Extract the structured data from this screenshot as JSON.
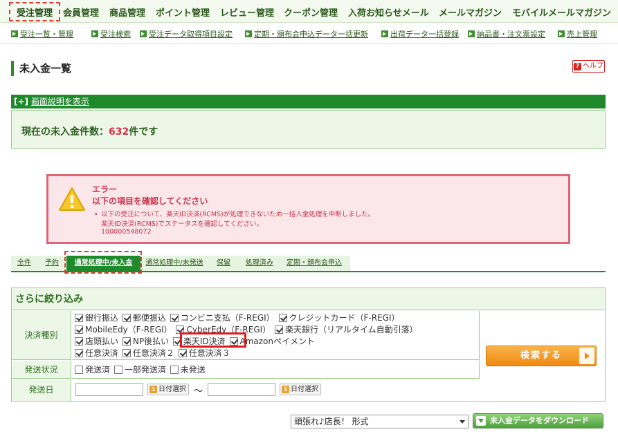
{
  "topnav": {
    "items": [
      "受注管理",
      "会員管理",
      "商品管理",
      "ポイント管理",
      "レビュー管理",
      "クーポン管理",
      "入荷お知らせメール",
      "メールマガジン",
      "モバイルメールマガジン"
    ]
  },
  "subnav": {
    "items": [
      "受注一覧・管理",
      "受注検索",
      "受注データ取得項目設定",
      "定期・頒布会申込データ一括更新",
      "出荷データ一括登録",
      "納品書・注文票設定",
      "売上管理"
    ]
  },
  "page": {
    "title": "未入金一覧",
    "help_label": "ヘルプ",
    "expander_prefix": "[+]",
    "expander_label": "画面説明を表示",
    "count_prefix": "現在の未入金件数：",
    "count_value": "632",
    "count_suffix": "件です"
  },
  "error": {
    "title": "エラー",
    "subtitle": "以下の項目を確認してください",
    "line1": "以下の受注について、楽天ID決済(RCMS)が処理できないため一括入金処理を中断しました。",
    "line2": "楽天ID決済(RCMS)でステータスを確認してください。",
    "order_no": "100000548072"
  },
  "tabs": [
    "全件",
    "予約",
    "通常処理中/未入金",
    "通常処理中/未発送",
    "保留",
    "処理済み",
    "定期・頒布会申込"
  ],
  "filter": {
    "title": "さらに絞り込み",
    "payment_label": "決済種別",
    "payment_options": [
      [
        "銀行振込",
        "郵便振込",
        "コンビニ支払（F-REGI）",
        "クレジットカード（F-REGI）"
      ],
      [
        "MobileEdy（F-REGI）",
        "CyberEdy（F-REGI）",
        "楽天銀行（リアルタイム自動引落）"
      ],
      [
        "店頭払い",
        "NP後払い",
        "楽天ID決済",
        "Amazonペイメント"
      ],
      [
        "任意決済",
        "任意決済２",
        "任意決済３"
      ]
    ],
    "shipping_label": "発送状況",
    "shipping_options": [
      "発送済",
      "一部発送済",
      "未発送"
    ],
    "date_label": "発送日",
    "date_btn_label": "日付選択",
    "date_btn_icon": "1",
    "tilde": "～",
    "search_label": "検索する"
  },
  "bottom": {
    "format_selected": "頑張れ♪店長！ 形式",
    "download_label": "未入金データをダウンロード"
  },
  "colors": {
    "green": "#1f8a2c",
    "error_red": "#e06478",
    "orange": "#ef8a12"
  }
}
